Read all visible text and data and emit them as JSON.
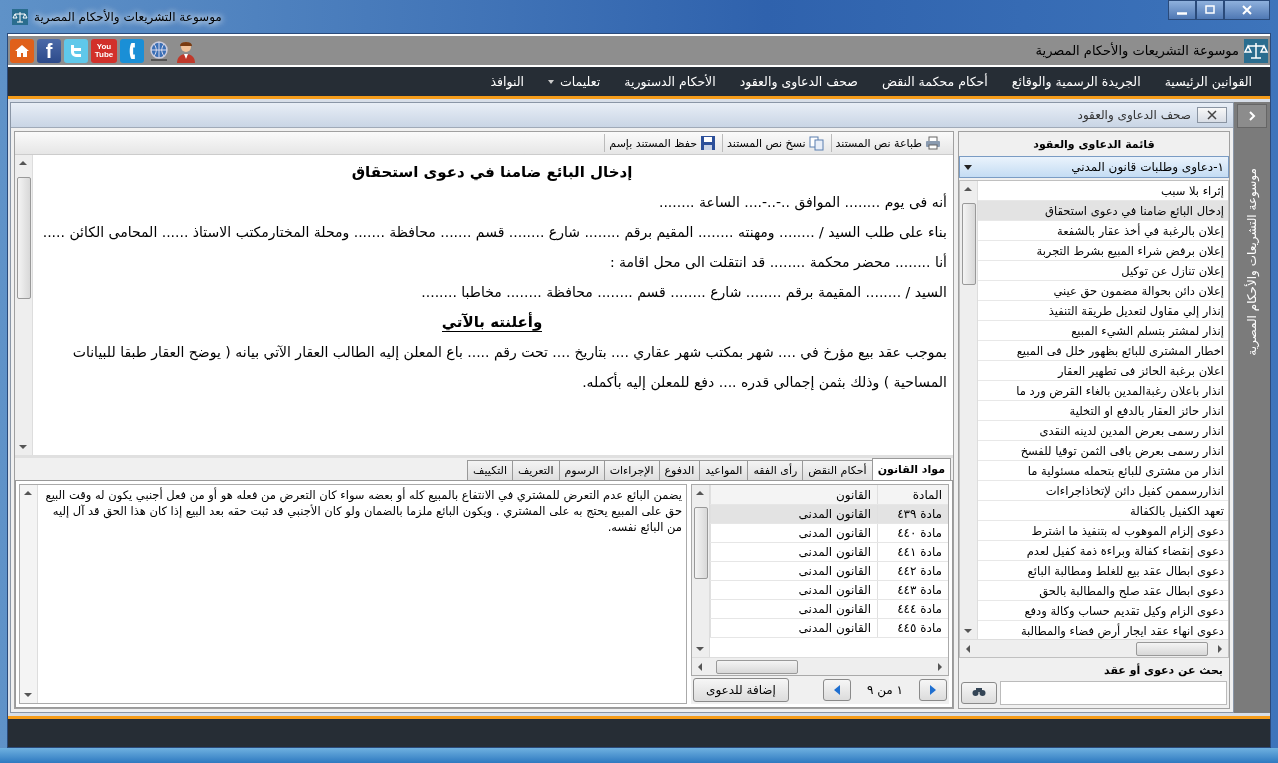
{
  "window": {
    "title": "موسوعة التشريعات والأحكام المصرية"
  },
  "toolbar": {
    "links": [
      {
        "kind": "support"
      },
      {
        "kind": "globe"
      },
      {
        "kind": "phone"
      },
      {
        "kind": "youtube",
        "label": "You Tube"
      },
      {
        "kind": "twitter"
      },
      {
        "kind": "facebook",
        "label": "f"
      },
      {
        "kind": "home"
      }
    ],
    "title": "موسوعة التشريعات والأحكام المصرية"
  },
  "menu": [
    {
      "label": "القوانين الرئيسية",
      "has_dropdown": false
    },
    {
      "label": "الجريدة الرسمية والوقائع",
      "has_dropdown": false
    },
    {
      "label": "أحكام محكمة النقض",
      "has_dropdown": false
    },
    {
      "label": "صحف الدعاوى والعقود",
      "has_dropdown": false
    },
    {
      "label": "الأحكام الدستورية",
      "has_dropdown": false
    },
    {
      "label": "تعليمات",
      "has_dropdown": true
    },
    {
      "label": "النوافذ",
      "has_dropdown": false
    }
  ],
  "document_tab": {
    "title": "صحف الدعاوى والعقود"
  },
  "side_strip": {
    "title": "موسوعة التشريعات والأحكام المصرية"
  },
  "doc_toolbar": [
    {
      "kind": "print",
      "label": "طباعة نص المستند"
    },
    {
      "kind": "copy",
      "label": "نسخ نص المستند"
    },
    {
      "kind": "save",
      "label": "حفظ المستند بإسم"
    }
  ],
  "document": [
    {
      "kind": "heading",
      "text": "إدخال البائع ضامنا في دعوى استحقاق"
    },
    {
      "kind": "para",
      "text": "أنه فى يوم ........ الموافق ..-..-.... الساعة ........"
    },
    {
      "kind": "para",
      "text": "بناء على طلب السيد / ........ ومهنته ........ المقيم برقم ........ شارع ........ قسم ....... محافظة ....... ومحلة المختارمكتب الاستاذ ...... المحامى الكائن ....."
    },
    {
      "kind": "para",
      "text": "أنا ........ محضر محكمة ........ قد انتقلت الى محل اقامة :"
    },
    {
      "kind": "para",
      "text": "السيد / ........ المقيمة برقم ........ شارع ........ قسم ........ محافظة ........ مخاطبا ........"
    },
    {
      "kind": "subheading",
      "text": "وأعلنته بالآتي"
    },
    {
      "kind": "para",
      "text": "بموجب عقد بيع مؤرخ في .... شهر بمكتب شهر عقاري .... بتاريخ .... تحت رقم ..... باع المعلن إليه الطالب العقار الآتي بيانه ( يوضح العقار طبقا للبيانات المساحية ) وذلك بثمن إجمالي قدره .... دفع للمعلن إليه بأكمله."
    }
  ],
  "bottom_tabs": [
    {
      "label": "مواد القانون",
      "selected": true
    },
    {
      "label": "أحكام النقض",
      "selected": false
    },
    {
      "label": "رأى الفقه",
      "selected": false
    },
    {
      "label": "المواعيد",
      "selected": false
    },
    {
      "label": "الدفوع",
      "selected": false
    },
    {
      "label": "الإجراءات",
      "selected": false
    },
    {
      "label": "الرسوم",
      "selected": false
    },
    {
      "label": "التعريف",
      "selected": false
    },
    {
      "label": "التكييف",
      "selected": false
    }
  ],
  "articles": {
    "columns": [
      "المادة",
      "القانون"
    ],
    "rows": [
      {
        "article": "مادة ٤٣٩",
        "law": "القانون المدنى",
        "selected": true
      },
      {
        "article": "مادة ٤٤٠",
        "law": "القانون المدنى",
        "selected": false
      },
      {
        "article": "مادة ٤٤١",
        "law": "القانون المدنى",
        "selected": false
      },
      {
        "article": "مادة ٤٤٢",
        "law": "القانون المدنى",
        "selected": false
      },
      {
        "article": "مادة ٤٤٣",
        "law": "القانون المدنى",
        "selected": false
      },
      {
        "article": "مادة ٤٤٤",
        "law": "القانون المدنى",
        "selected": false
      },
      {
        "article": "مادة ٤٤٥",
        "law": "القانون المدنى",
        "selected": false
      }
    ],
    "pager": "١ من ٩",
    "add_button": "إضافة للدعوى"
  },
  "article_text": "يضمن البائع عدم التعرض للمشتري في الانتفاع بالمبيع كله أو بعضه سواء كان التعرض من فعله هو أو من فعل أجنبي يكون له وقت البيع حق على المبيع يحتج به على المشتري . ويكون البائع ملزما بالضمان ولو كان الأجنبي قد ثبت حقه بعد البيع إذا كان هذا الحق قد آل إليه من البائع نفسه.",
  "list_panel": {
    "title": "قائمة الدعاوى والعقود",
    "category": "١-دعاوى وطلبات قانون المدني",
    "items": [
      {
        "label": "إثراء بلا سبب",
        "selected": false
      },
      {
        "label": "إدخال البائع ضامنا في دعوى استحقاق",
        "selected": true
      },
      {
        "label": "إعلان بالرغبة في أخذ عقار بالشفعة",
        "selected": false
      },
      {
        "label": "إعلان برفض شراء المبيع بشرط التجربة",
        "selected": false
      },
      {
        "label": "إعلان تنازل عن توكيل",
        "selected": false
      },
      {
        "label": "إعلان دائن بحوالة مضمون حق عيني",
        "selected": false
      },
      {
        "label": "إنذار إلي مقاول لتعديل طريقة التنفيذ",
        "selected": false
      },
      {
        "label": "إنذار لمشتر بتسلم الشيء المبيع",
        "selected": false
      },
      {
        "label": "اخطار المشترى للبائع بظهور خلل فى المبيع",
        "selected": false
      },
      {
        "label": "اعلان برغبة الحائز فى تطهير العقار",
        "selected": false
      },
      {
        "label": "انذار باعلان رغبةالمدين بالغاء القرض ورد ما",
        "selected": false
      },
      {
        "label": "انذار حائز العقار بالدفع او التخلية",
        "selected": false
      },
      {
        "label": "انذار رسمى بعرض المدين لدينه النقدى",
        "selected": false
      },
      {
        "label": "انذار رسمى بعرض باقى الثمن توقيا للفسخ",
        "selected": false
      },
      {
        "label": "انذار من مشترى للبائع بتحمله مسئولية ما",
        "selected": false
      },
      {
        "label": "انذاررسممن كفيل دائن لإتخاذاجراءات",
        "selected": false
      },
      {
        "label": "تعهد الكفيل بالكفالة",
        "selected": false
      },
      {
        "label": "دعوى إلزام الموهوب له بتنفيذ ما اشترط",
        "selected": false
      },
      {
        "label": "دعوى إنقضاء كفالة وبراءة ذمة كفيل لعدم",
        "selected": false
      },
      {
        "label": "دعوى ابطال عقد بيع للغلط ومطالبة البائع",
        "selected": false
      },
      {
        "label": "دعوى ابطال عقد صلح والمطالبة بالحق",
        "selected": false
      },
      {
        "label": "دعوى الزام وكيل تقديم حساب وكالة ودفع",
        "selected": false
      },
      {
        "label": "دعوى انهاء عقد ايجار أرض فضاء والمطالبة",
        "selected": false
      }
    ],
    "search_label": "بحث عن دعوى أو عقد"
  }
}
